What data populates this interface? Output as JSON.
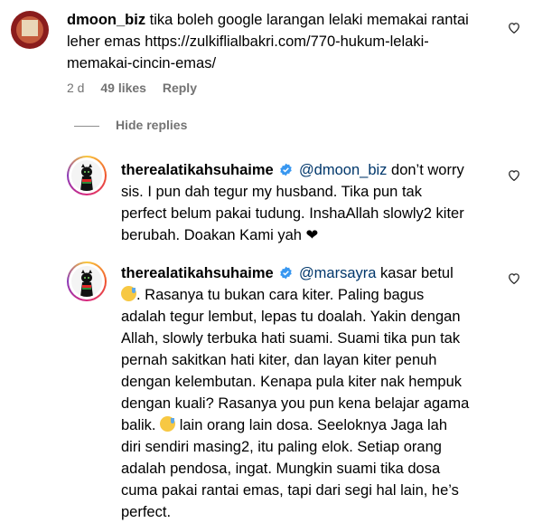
{
  "comments": [
    {
      "username": "dmoon_biz",
      "text": "tika boleh google larangan lelaki memakai rantai leher emas https://zulkiflialbakri.com/770-hukum-lelaki-memakai-cincin-emas/",
      "line1": "tika boleh google larangan lelaki memakai rantai",
      "line2": "leher emas https://zulkiflialbakri.com/770-hukum-lelaki-",
      "line3": "memakai-cincin-emas/",
      "time": "2 d",
      "likes": "49 likes",
      "reply": "Reply"
    }
  ],
  "hide_replies": "Hide replies",
  "replies": [
    {
      "username": "therealatikahsuhaime",
      "mention": "@dmoon_biz",
      "line1_rest": "don’t worry",
      "line2": "sis. I pun dah tegur my husband. Tika pun tak",
      "line3": "perfect belum pakai tudung. InshaAllah slowly2 kiter",
      "line4": "berubah. Doakan Kami yah ❤"
    },
    {
      "username": "therealatikahsuhaime",
      "mention": "@marsayra",
      "line1_rest": "kasar betul",
      "line2_rest": ". Rasanya tu bukan cara kiter. Paling bagus",
      "line3": "adalah tegur lembut, lepas tu doalah. Yakin dengan",
      "line4": "Allah, slowly terbuka hati suami. Suami tika pun tak",
      "line5": "pernah sakitkan hati kiter, dan layan kiter penuh",
      "line6": "dengan kelembutan. Kenapa pula kiter nak hempuk",
      "line7": "dengan kuali? Rasanya you pun kena belajar agama",
      "line8_a": "balik.",
      "line8_b": "lain orang lain dosa. Seeloknya Jaga lah",
      "line9": "diri sendiri masing2, itu paling elok. Setiap orang",
      "line10": "adalah pendosa, ingat. Mungkin suami tika dosa",
      "line11": "cuma pakai rantai emas, tapi dari segi hal lain, he’s",
      "line12": "perfect."
    }
  ],
  "icons": {
    "heart": "heart-outline-icon",
    "verified": "verified-badge-icon",
    "emoji": "sweat-smile-emoji"
  },
  "colors": {
    "meta": "#737373",
    "mention": "#00376b",
    "verified": "#3897f0"
  }
}
